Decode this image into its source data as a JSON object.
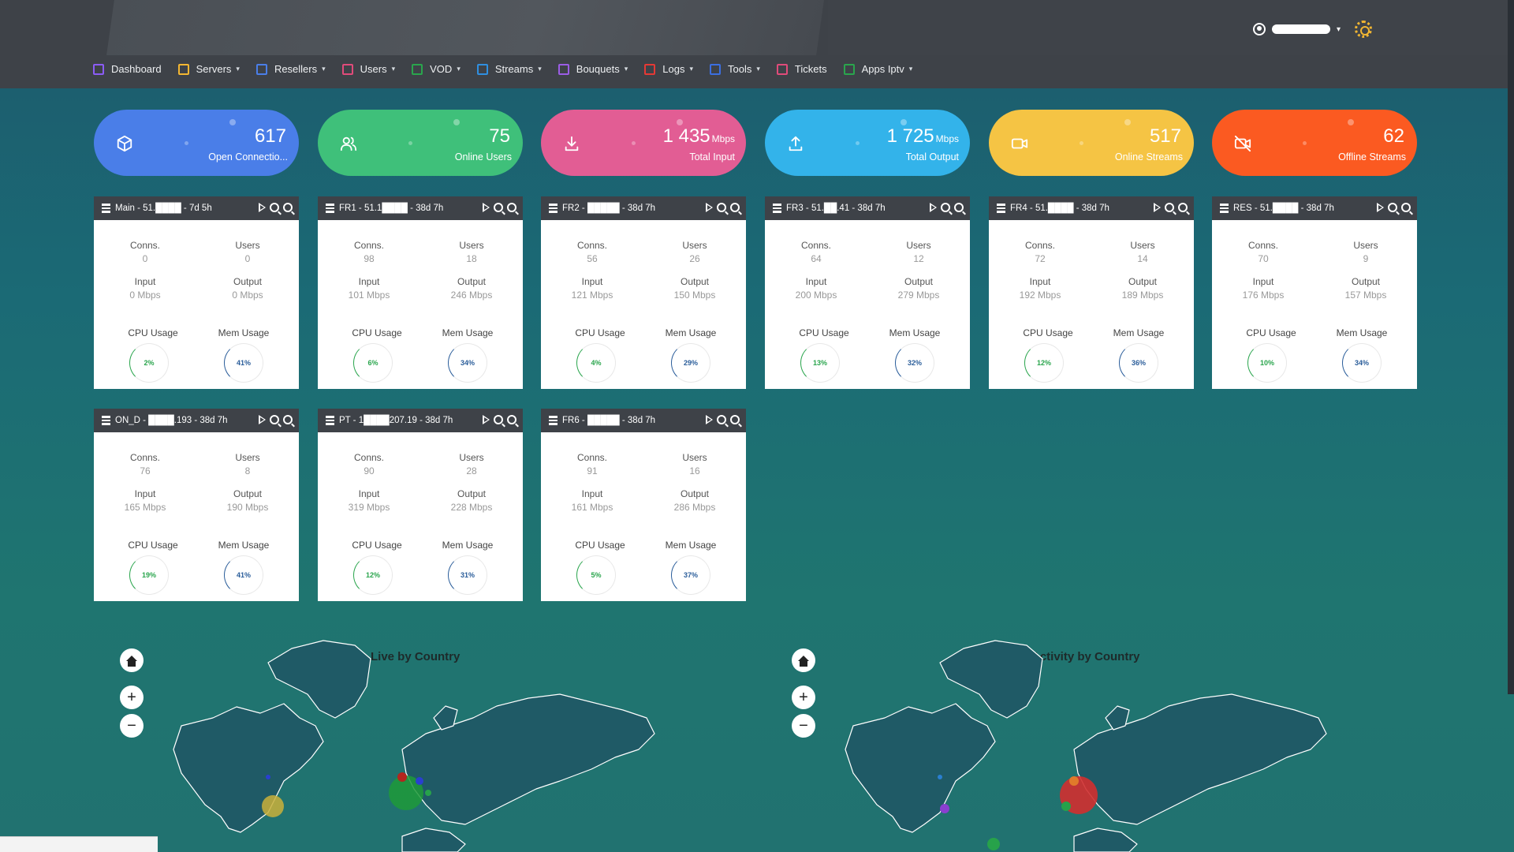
{
  "header": {
    "user_name": "",
    "nav": [
      {
        "label": "Dashboard",
        "icon": "dashboard-icon",
        "color": "#8b5cf6",
        "dropdown": false
      },
      {
        "label": "Servers",
        "icon": "servers-icon",
        "color": "#f2b632",
        "dropdown": true
      },
      {
        "label": "Resellers",
        "icon": "resellers-icon",
        "color": "#4a7ee8",
        "dropdown": true
      },
      {
        "label": "Users",
        "icon": "users-icon",
        "color": "#e04b7a",
        "dropdown": true
      },
      {
        "label": "VOD",
        "icon": "vod-icon",
        "color": "#2aa54d",
        "dropdown": true
      },
      {
        "label": "Streams",
        "icon": "streams-icon",
        "color": "#2f8fe0",
        "dropdown": true
      },
      {
        "label": "Bouquets",
        "icon": "bouquets-icon",
        "color": "#9b5de5",
        "dropdown": true
      },
      {
        "label": "Logs",
        "icon": "logs-icon",
        "color": "#e53935",
        "dropdown": true
      },
      {
        "label": "Tools",
        "icon": "tools-icon",
        "color": "#3b6fe0",
        "dropdown": true
      },
      {
        "label": "Tickets",
        "icon": "tickets-icon",
        "color": "#e04b7a",
        "dropdown": false
      },
      {
        "label": "Apps Iptv",
        "icon": "apps-icon",
        "color": "#2aa54d",
        "dropdown": true
      }
    ]
  },
  "stats": [
    {
      "value": "617",
      "unit": "",
      "label": "Open Connectio...",
      "icon": "cube-icon",
      "color": "#4a7ee8"
    },
    {
      "value": "75",
      "unit": "",
      "label": "Online Users",
      "icon": "users-icon",
      "color": "#3fc07a"
    },
    {
      "value": "1 435",
      "unit": "Mbps",
      "label": "Total Input",
      "icon": "download-icon",
      "color": "#e25d94"
    },
    {
      "value": "1 725",
      "unit": "Mbps",
      "label": "Total Output",
      "icon": "upload-icon",
      "color": "#33b3ea"
    },
    {
      "value": "517",
      "unit": "",
      "label": "Online Streams",
      "icon": "video-icon",
      "color": "#f5c444"
    },
    {
      "value": "62",
      "unit": "",
      "label": "Offline Streams",
      "icon": "video-off-icon",
      "color": "#fb5a21"
    }
  ],
  "labels": {
    "conns": "Conns.",
    "users": "Users",
    "input": "Input",
    "output": "Output",
    "cpu": "CPU Usage",
    "mem": "Mem Usage"
  },
  "servers": [
    {
      "title": "Main - 51.████ - 7d 5h",
      "conns": "0",
      "users": "0",
      "input": "0 Mbps",
      "output": "0 Mbps",
      "cpu": "2%",
      "mem": "41%"
    },
    {
      "title": "FR1 - 51.1████ - 38d 7h",
      "conns": "98",
      "users": "18",
      "input": "101 Mbps",
      "output": "246 Mbps",
      "cpu": "6%",
      "mem": "34%"
    },
    {
      "title": "FR2 - █████ - 38d 7h",
      "conns": "56",
      "users": "26",
      "input": "121 Mbps",
      "output": "150 Mbps",
      "cpu": "4%",
      "mem": "29%"
    },
    {
      "title": "FR3 - 51.██.41 - 38d 7h",
      "conns": "64",
      "users": "12",
      "input": "200 Mbps",
      "output": "279 Mbps",
      "cpu": "13%",
      "mem": "32%"
    },
    {
      "title": "FR4 - 51.████ - 38d 7h",
      "conns": "72",
      "users": "14",
      "input": "192 Mbps",
      "output": "189 Mbps",
      "cpu": "12%",
      "mem": "36%"
    },
    {
      "title": "RES - 51.████ - 38d 7h",
      "conns": "70",
      "users": "9",
      "input": "176 Mbps",
      "output": "157 Mbps",
      "cpu": "10%",
      "mem": "34%"
    },
    {
      "title": "ON_D - ████.193 - 38d 7h",
      "conns": "76",
      "users": "8",
      "input": "165 Mbps",
      "output": "190 Mbps",
      "cpu": "19%",
      "mem": "41%"
    },
    {
      "title": "PT - 1████207.19 - 38d 7h",
      "conns": "90",
      "users": "28",
      "input": "319 Mbps",
      "output": "228 Mbps",
      "cpu": "12%",
      "mem": "31%"
    },
    {
      "title": "FR6 - █████ - 38d 7h",
      "conns": "91",
      "users": "16",
      "input": "161 Mbps",
      "output": "286 Mbps",
      "cpu": "5%",
      "mem": "37%"
    }
  ],
  "maps": [
    {
      "title": "Live by Country"
    },
    {
      "title": "Activity by Country"
    }
  ]
}
